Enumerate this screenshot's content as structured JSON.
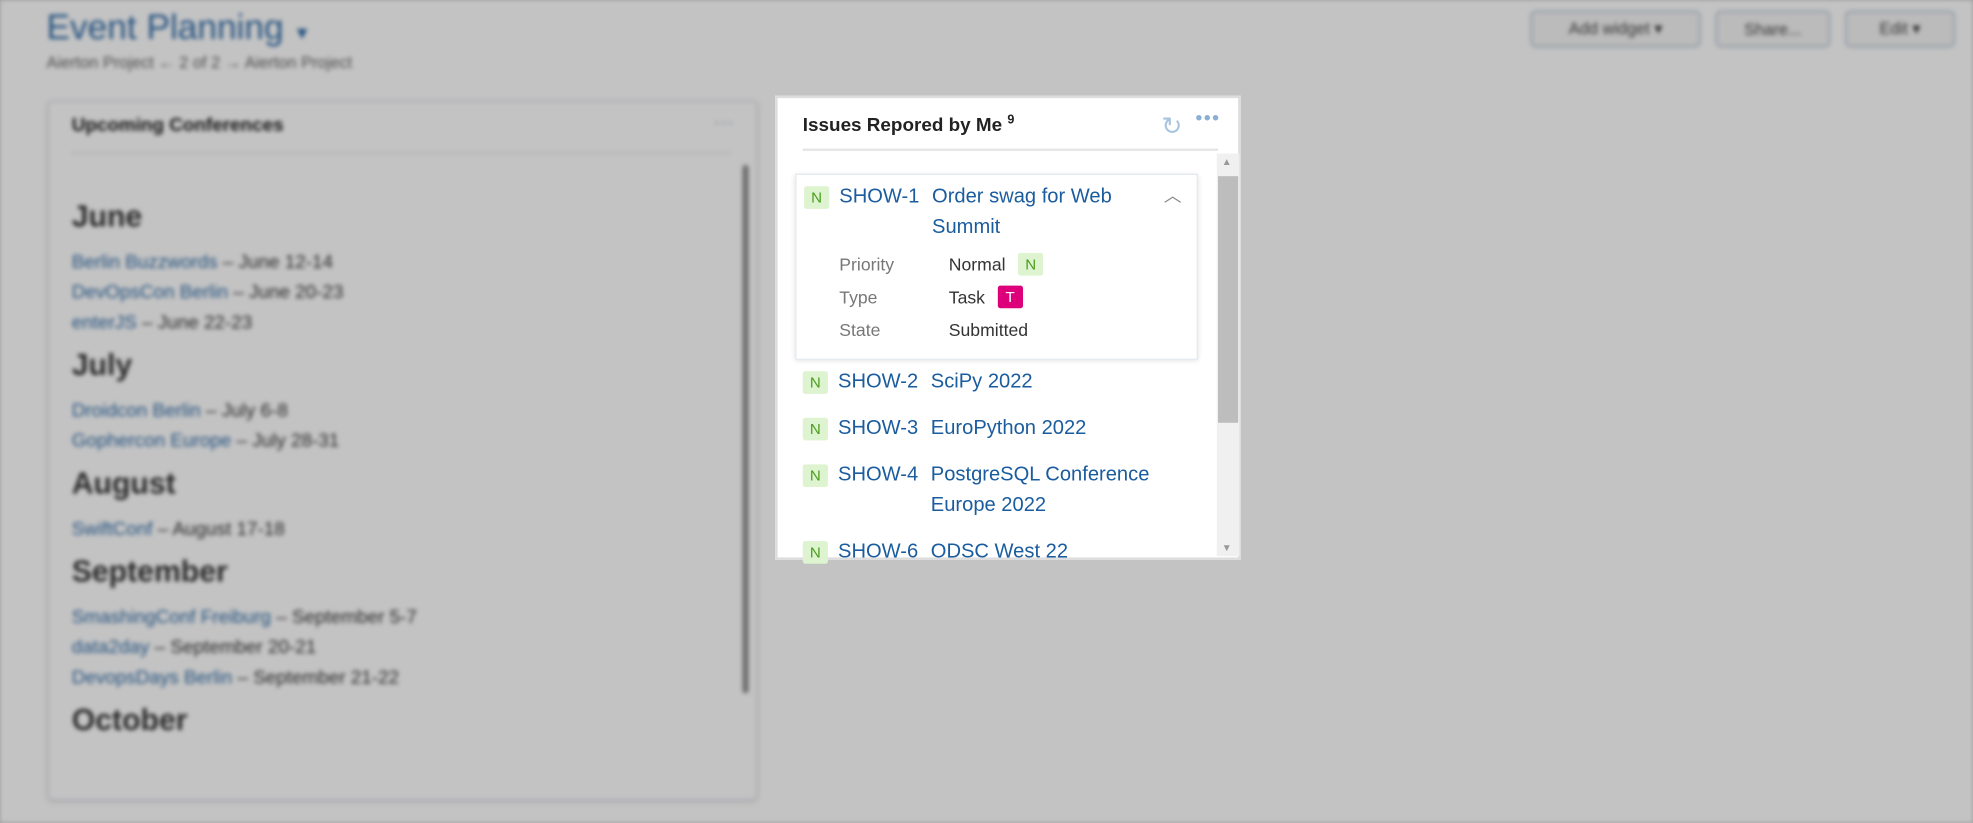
{
  "page": {
    "title": "Event Planning",
    "breadcrumb": "Aierton Project  ← 2 of 2 →  Aierton Project",
    "buttons": {
      "add_widget": "Add widget ▾",
      "share": "Share...",
      "edit": "Edit ▾"
    }
  },
  "left_widget": {
    "title": "Upcoming Conferences",
    "menu": "···",
    "months": [
      {
        "name": "June",
        "items": [
          {
            "link": "Berlin Buzzwords",
            "date": " – June 12-14"
          },
          {
            "link": "DevOpsCon Berlin",
            "date": " – June 20-23"
          },
          {
            "link": "enterJS",
            "date": " – June 22-23"
          }
        ]
      },
      {
        "name": "July",
        "items": [
          {
            "link": "Droidcon Berlin",
            "date": " – July 6-8"
          },
          {
            "link": "Gophercon Europe",
            "date": " – July 28-31"
          }
        ]
      },
      {
        "name": "August",
        "items": [
          {
            "link": "SwiftConf",
            "date": " – August 17-18"
          }
        ]
      },
      {
        "name": "September",
        "items": [
          {
            "link": "SmashingConf Freiburg",
            "date": " – September 5-7"
          },
          {
            "link": "data2day",
            "date": " – September 20-21"
          },
          {
            "link": "DevopsDays Berlin",
            "date": " – September 21-22"
          }
        ]
      },
      {
        "name": "October",
        "items": []
      }
    ]
  },
  "widget": {
    "title": "Issues Repored by Me",
    "count": "9",
    "refresh_icon": "refresh-icon",
    "menu": "•••",
    "expanded": {
      "priority_badge": "N",
      "id": "SHOW-1",
      "summary": "Order swag for Web Summit",
      "fields": [
        {
          "label": "Priority",
          "value": "Normal",
          "badge": "N"
        },
        {
          "label": "Type",
          "value": "Task",
          "badge": "T"
        },
        {
          "label": "State",
          "value": "Submitted"
        }
      ]
    },
    "issues": [
      {
        "badge": "N",
        "id": "SHOW-2",
        "summary": "SciPy 2022"
      },
      {
        "badge": "N",
        "id": "SHOW-3",
        "summary": "EuroPython 2022"
      },
      {
        "badge": "N",
        "id": "SHOW-4",
        "summary": "PostgreSQL Conference Europe 2022"
      },
      {
        "badge": "N",
        "id": "SHOW-6",
        "summary": "ODSC West 22"
      }
    ]
  },
  "colors": {
    "link": "#1a5c9e",
    "normal_badge": "#def3cf",
    "task_badge": "#dd007a"
  }
}
